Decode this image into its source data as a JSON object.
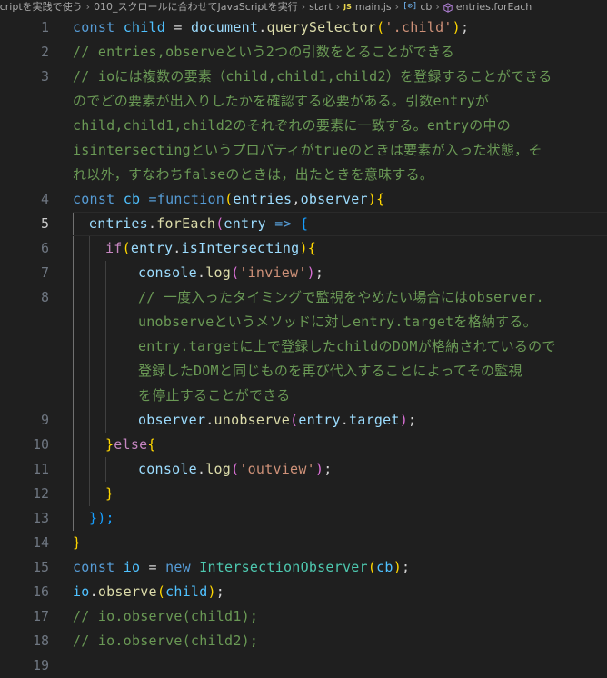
{
  "breadcrumb": {
    "items": [
      "scriptを実践で使う",
      "010_スクロールに合わせてJavaScriptを実行",
      "start",
      "main.js",
      "cb",
      "entries.forEach"
    ],
    "separator": "›",
    "js_badge": "JS",
    "var_badge": "[⊘]"
  },
  "line_numbers": {
    "l1": "1",
    "l2": "2",
    "l3": "3",
    "l4": "4",
    "l5": "5",
    "l6": "6",
    "l7": "7",
    "l8": "8",
    "l9": "9",
    "l10": "10",
    "l11": "11",
    "l12": "12",
    "l13": "13",
    "l14": "14",
    "l15": "15",
    "l16": "16",
    "l17": "17",
    "l18": "18",
    "l19": "19"
  },
  "tokens": {
    "const": "const",
    "child": "child",
    "eq": "=",
    "document": "document",
    "dot": ".",
    "querySelector": "querySelector",
    "lparen": "(",
    "rparen": ")",
    "str_child": "'.child'",
    "semi": ";",
    "cb": "cb",
    "eq_function": "=function",
    "entries": "entries",
    "comma": ",",
    "observer": "observer",
    "lbrace": "{",
    "rbrace": "}",
    "forEach": "forEach",
    "entry": "entry",
    "arrow": "=>",
    "if": "if",
    "isIntersecting": "isIntersecting",
    "console": "console",
    "log": "log",
    "str_inview": "'inview'",
    "unobserve": "unobserve",
    "target": "target",
    "else": "else",
    "str_outview": "'outview'",
    "close_13": "});",
    "io": "io",
    "new": "new",
    "IntersectionObserver": "IntersectionObserver",
    "observe": "observe"
  },
  "comments": {
    "c2": "// entries,observeという2つの引数をとることができる",
    "c3_1": "// ioには複数の要素（child,child1,child2）を登録することができる",
    "c3_2": "のでどの要素が出入りしたかを確認する必要がある。引数entryが",
    "c3_3": "child,child1,child2のそれぞれの要素に一致する。entryの中の",
    "c3_4": "isintersectingというプロパティがtrueのときは要素が入った状態，そ",
    "c3_5": "れ以外，すなわちfalseのときは，出たときを意味する。",
    "c8_1": "// 一度入ったタイミングで監視をやめたい場合にはobserver.",
    "c8_2": "unobserveというメソッドに対しentry.targetを格納する。",
    "c8_3": "entry.targetに上で登録したchildのDOMが格納されているので",
    "c8_4": "登録したDOMと同じものを再び代入することによってその監視",
    "c8_5": "を停止することができる",
    "c17": "// io.observe(child1);",
    "c18": "// io.observe(child2);"
  },
  "colors": {
    "background": "#1f1f1f",
    "keyword": "#569cd6",
    "control": "#c586c0",
    "variable": "#9cdcfe",
    "function": "#dcdcaa",
    "class": "#4ec9b0",
    "string": "#ce9178",
    "comment": "#6a9955",
    "line_number": "#6e7681"
  },
  "icons": {
    "js_file": "javascript-file-icon",
    "variable": "variable-icon",
    "method": "method-cube-icon"
  }
}
